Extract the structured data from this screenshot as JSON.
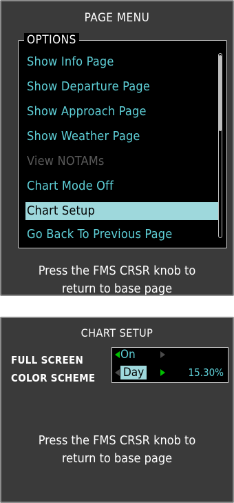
{
  "page_menu": {
    "title": "PAGE MENU",
    "options_label": "OPTIONS",
    "items": [
      {
        "label": "Show Info Page",
        "state": "enabled"
      },
      {
        "label": "Show Departure Page",
        "state": "enabled"
      },
      {
        "label": "Show Approach Page",
        "state": "enabled"
      },
      {
        "label": "Show Weather Page",
        "state": "enabled"
      },
      {
        "label": "View NOTAMs",
        "state": "disabled"
      },
      {
        "label": "Chart Mode Off",
        "state": "enabled"
      },
      {
        "label": "Chart Setup",
        "state": "selected"
      },
      {
        "label": "Go Back To Previous Page",
        "state": "enabled"
      }
    ],
    "instruction_line1": "Press the FMS CRSR knob to",
    "instruction_line2": "return to base page"
  },
  "chart_setup": {
    "title": "CHART SETUP",
    "full_screen_label": "FULL SCREEN",
    "full_screen_value": "On",
    "color_scheme_label": "COLOR SCHEME",
    "color_scheme_value": "Day",
    "percentage": "15.30%",
    "instruction_line1": "Press the FMS CRSR knob to",
    "instruction_line2": "return to base page"
  },
  "colors": {
    "panel_bg": "#3a3a3a",
    "menu_text": "#5fd1d9",
    "selection_bg": "#9ed8dc",
    "disabled_text": "#5a5a5a",
    "arrow_green": "#00c000"
  }
}
